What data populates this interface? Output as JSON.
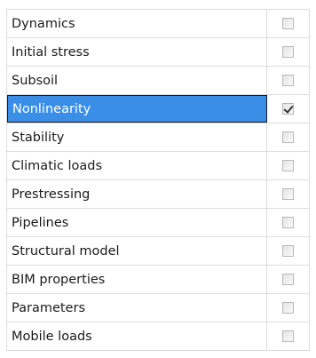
{
  "options": {
    "items": [
      {
        "label": "Dynamics",
        "checked": false,
        "selected": false
      },
      {
        "label": "Initial stress",
        "checked": false,
        "selected": false
      },
      {
        "label": "Subsoil",
        "checked": false,
        "selected": false
      },
      {
        "label": "Nonlinearity",
        "checked": true,
        "selected": true
      },
      {
        "label": "Stability",
        "checked": false,
        "selected": false
      },
      {
        "label": "Climatic loads",
        "checked": false,
        "selected": false
      },
      {
        "label": "Prestressing",
        "checked": false,
        "selected": false
      },
      {
        "label": "Pipelines",
        "checked": false,
        "selected": false
      },
      {
        "label": "Structural model",
        "checked": false,
        "selected": false
      },
      {
        "label": "BIM properties",
        "checked": false,
        "selected": false
      },
      {
        "label": "Parameters",
        "checked": false,
        "selected": false
      },
      {
        "label": "Mobile loads",
        "checked": false,
        "selected": false
      }
    ],
    "colors": {
      "selection": "#3a8ee6",
      "grid": "#dcdcdc",
      "text": "#1a1a1a"
    }
  }
}
